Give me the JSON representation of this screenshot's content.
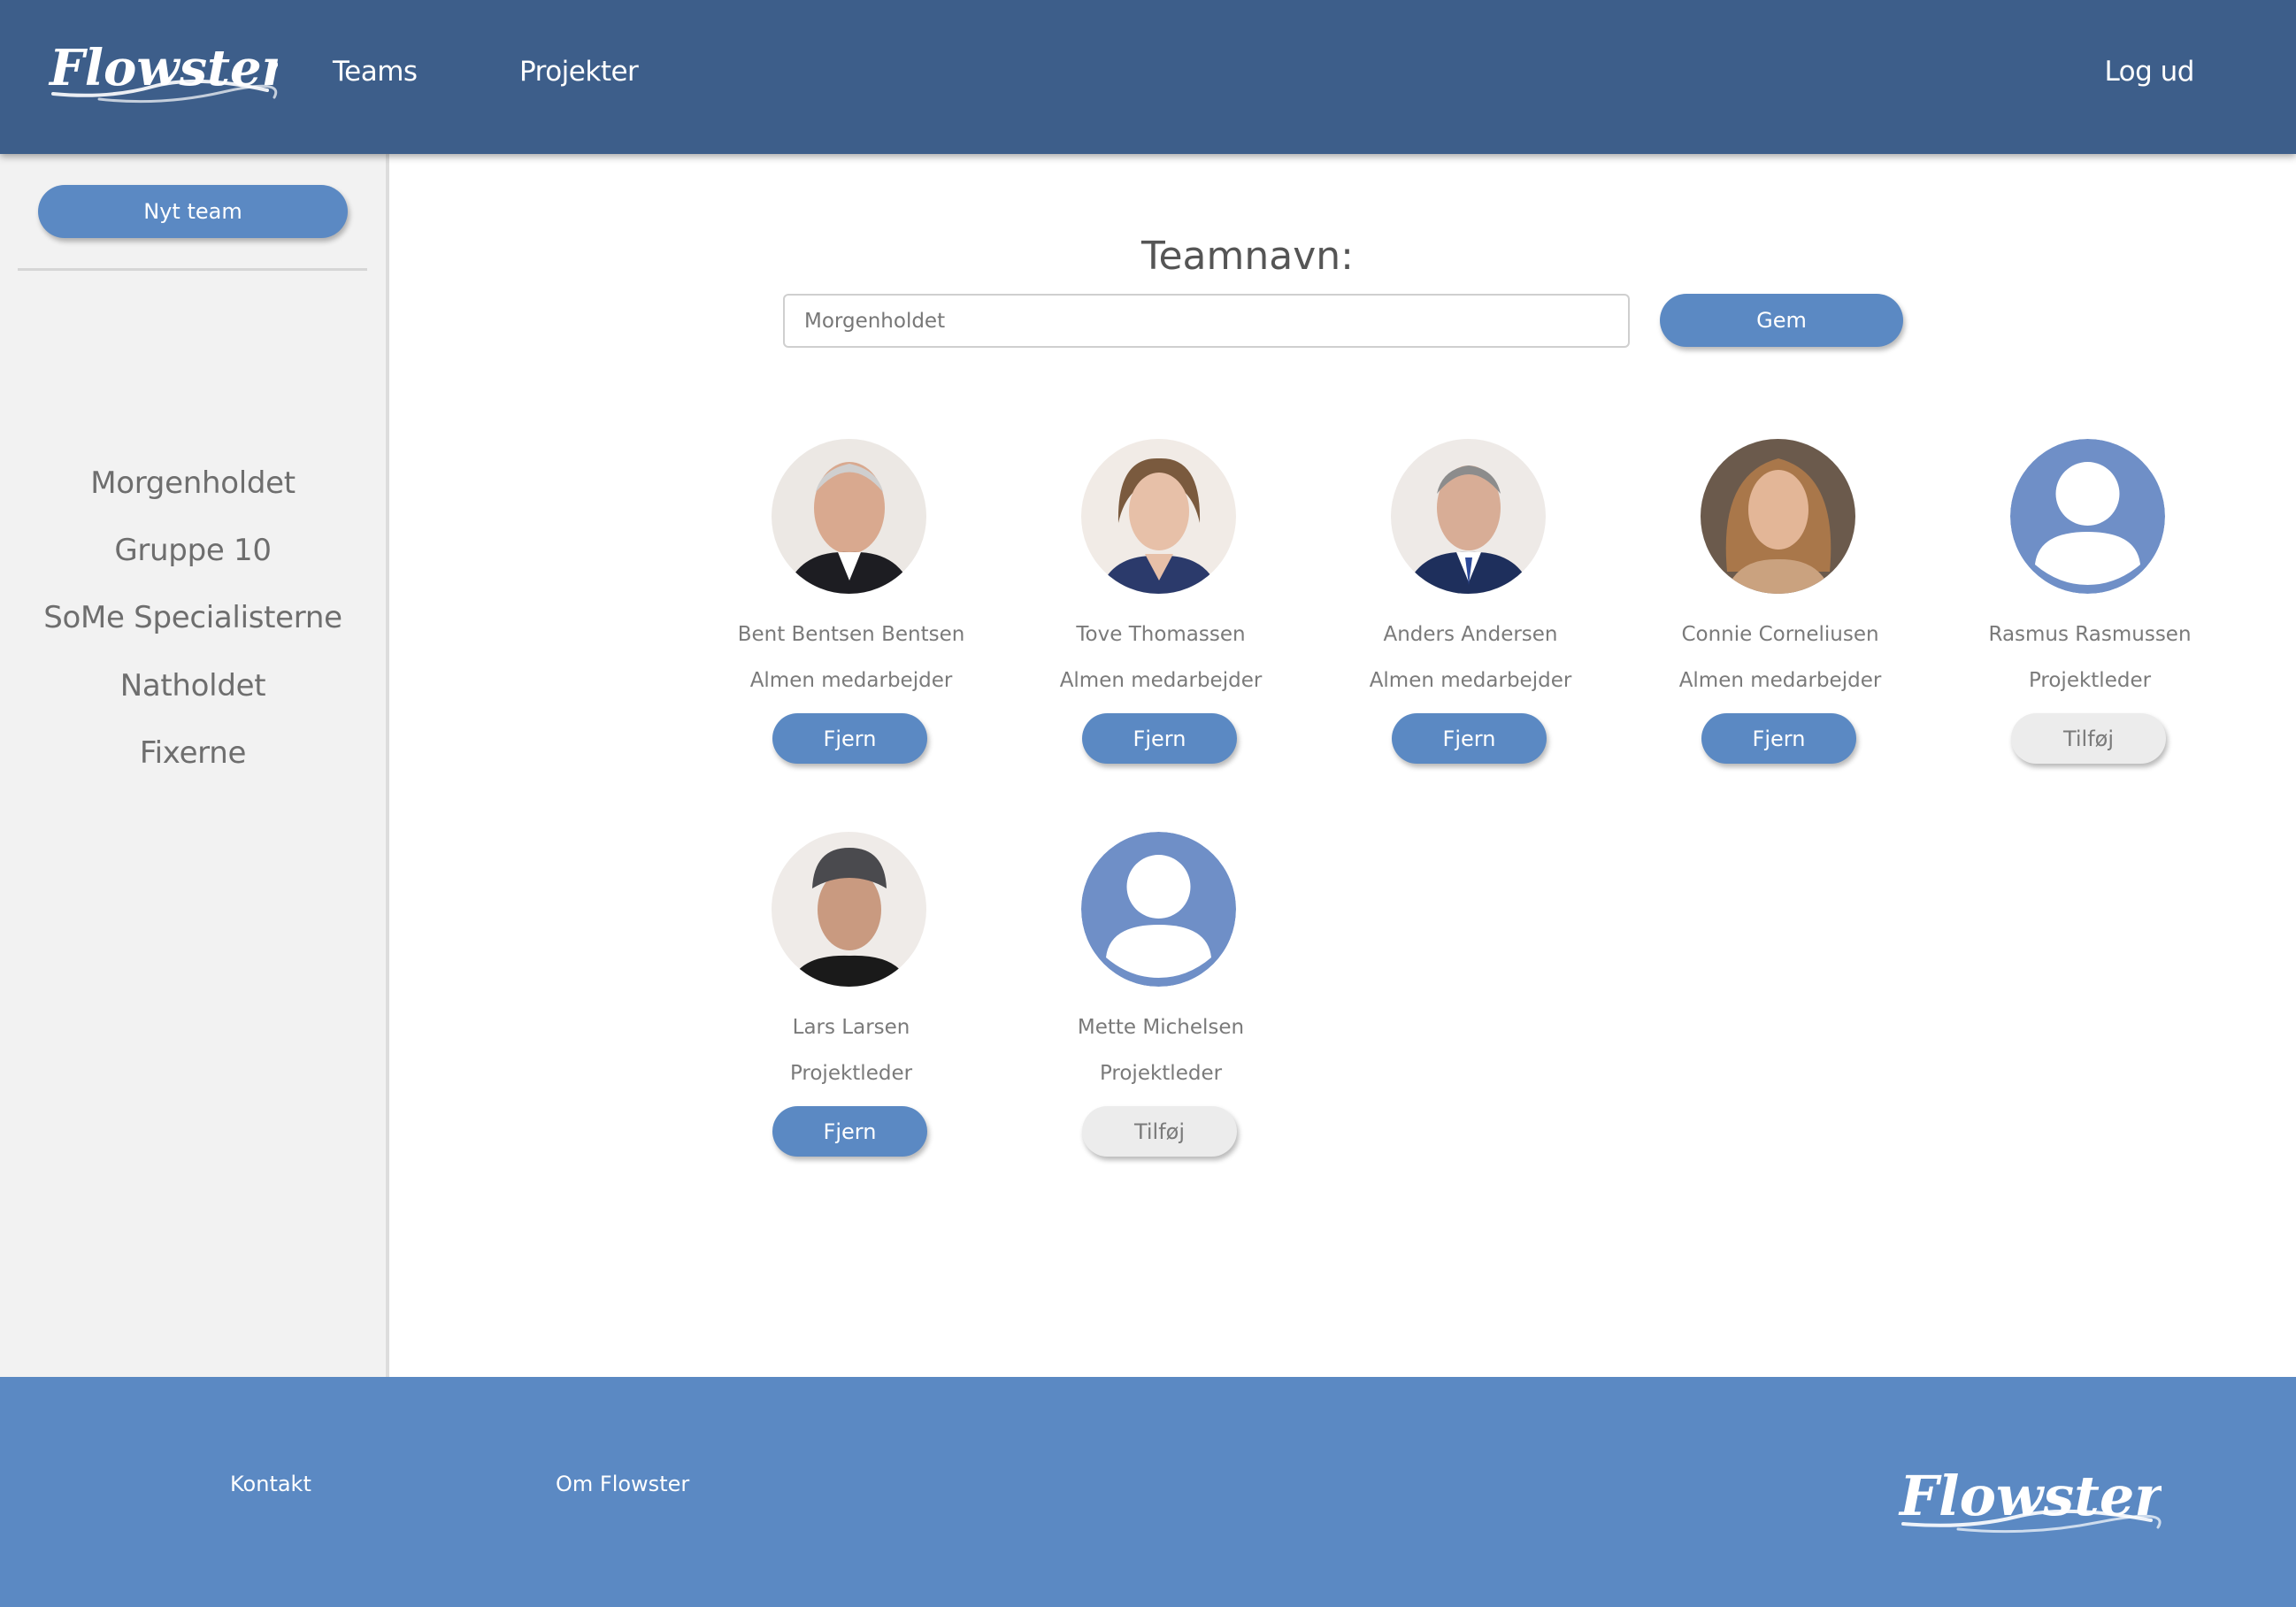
{
  "header": {
    "logo_text": "Flowster",
    "nav": {
      "teams": "Teams",
      "projects": "Projekter"
    },
    "logout": "Log ud"
  },
  "sidebar": {
    "new_team_button": "Nyt team",
    "teams": [
      {
        "label": "Morgenholdet"
      },
      {
        "label": "Gruppe 10"
      },
      {
        "label": "SoMe Specialisterne"
      },
      {
        "label": "Natholdet"
      },
      {
        "label": "Fixerne"
      }
    ]
  },
  "main": {
    "team_name_label": "Teamnavn:",
    "team_name_value": "Morgenholdet",
    "save_button": "Gem",
    "members": [
      {
        "name": "Bent Bentsen Bentsen",
        "role": "Almen medarbejder",
        "action": "Fjern",
        "avatar": "photo"
      },
      {
        "name": "Tove Thomassen",
        "role": "Almen medarbejder",
        "action": "Fjern",
        "avatar": "photo"
      },
      {
        "name": "Anders Andersen",
        "role": "Almen medarbejder",
        "action": "Fjern",
        "avatar": "photo"
      },
      {
        "name": "Connie Corneliusen",
        "role": "Almen medarbejder",
        "action": "Fjern",
        "avatar": "photo"
      },
      {
        "name": "Rasmus Rasmussen",
        "role": "Projektleder",
        "action": "Tilføj",
        "avatar": "default-user-icon"
      },
      {
        "name": "Lars Larsen",
        "role": "Projektleder",
        "action": "Fjern",
        "avatar": "photo"
      },
      {
        "name": "Mette Michelsen",
        "role": "Projektleder",
        "action": "Tilføj",
        "avatar": "default-user-icon"
      }
    ]
  },
  "footer": {
    "contact": "Kontakt",
    "about": "Om Flowster",
    "logo_text": "Flowster"
  },
  "colors": {
    "header_bg": "#3d5e8a",
    "accent_blue": "#5b89c3",
    "avatar_placeholder": "#6f8fc7",
    "sidebar_bg": "#f2f2f2",
    "add_button_bg": "#ececec"
  }
}
